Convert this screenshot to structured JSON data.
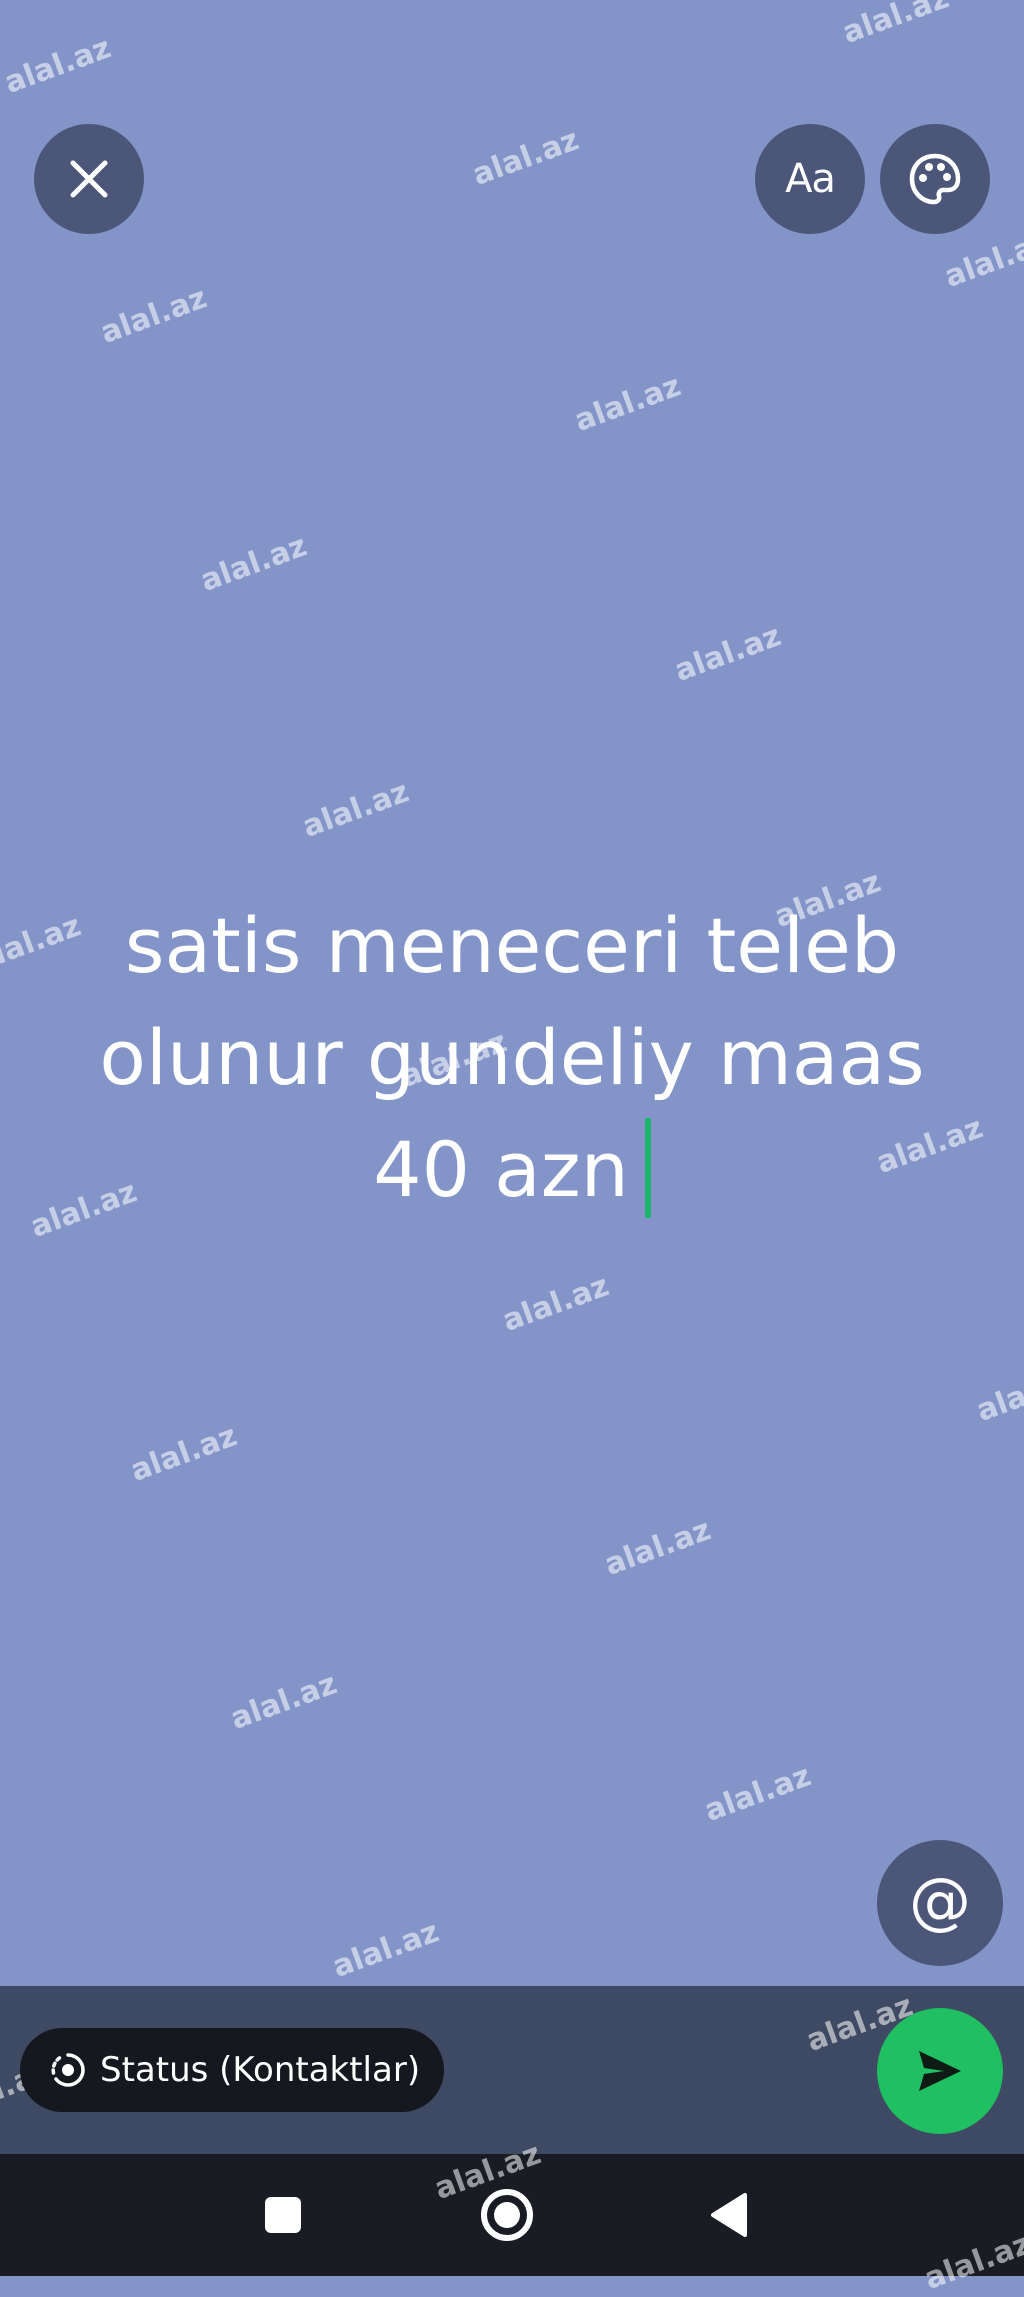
{
  "watermark_text": "alal.az",
  "status_editor": {
    "text_lines": [
      "satis meneceri teleb",
      "olunur gundeliy maas",
      "40 azn"
    ],
    "background_color": "#8394c9",
    "caret_color": "#1fb46d"
  },
  "toolbar": {
    "font_button_label": "Aa",
    "mention_glyph": "@"
  },
  "footer": {
    "audience_label": "Status (Kontaktlar)",
    "send_color": "#1fbf62"
  },
  "icons": {
    "close": "close-icon",
    "font": "text-style-icon",
    "palette": "palette-icon",
    "mention": "at-icon",
    "status": "status-ring-icon",
    "send": "send-arrow-icon",
    "nav_recents": "square-icon",
    "nav_home": "circle-icon",
    "nav_back": "triangle-back-icon"
  }
}
